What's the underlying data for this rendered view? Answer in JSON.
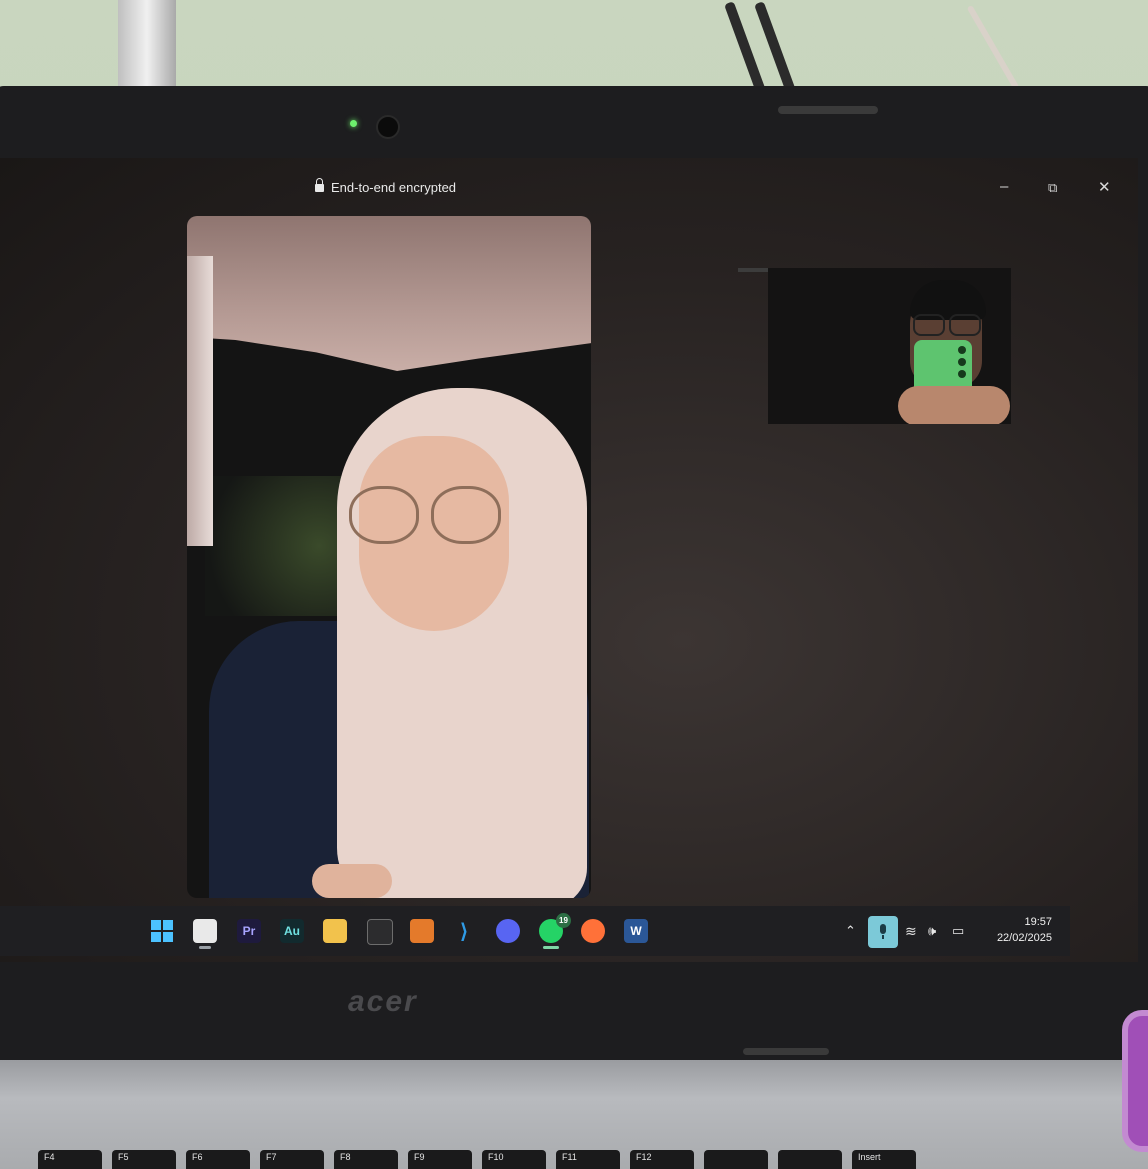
{
  "call_window": {
    "encryption_label": "End-to-end encrypted",
    "controls": {
      "minimize": "–",
      "restore": "⧉",
      "close": "✕"
    }
  },
  "taskbar": {
    "apps": [
      {
        "name": "start",
        "label": ""
      },
      {
        "name": "notepad",
        "label": ""
      },
      {
        "name": "premiere-pro",
        "label": "Pr"
      },
      {
        "name": "audition",
        "label": "Au"
      },
      {
        "name": "file-explorer",
        "label": ""
      },
      {
        "name": "davinci-resolve",
        "label": ""
      },
      {
        "name": "app-orange",
        "label": ""
      },
      {
        "name": "vscode",
        "label": ""
      },
      {
        "name": "discord",
        "label": ""
      },
      {
        "name": "whatsapp",
        "label": "",
        "badge": "19"
      },
      {
        "name": "firefox",
        "label": ""
      },
      {
        "name": "word",
        "label": "W"
      }
    ],
    "clock": {
      "time": "19:57",
      "date": "22/02/2025"
    }
  },
  "laptop": {
    "brand": "acer"
  },
  "keyboard": {
    "keys": [
      "F4",
      "F5",
      "F6",
      "F7",
      "F8",
      "F9",
      "F10",
      "F11",
      "F12",
      "",
      "",
      "Insert",
      ""
    ]
  }
}
